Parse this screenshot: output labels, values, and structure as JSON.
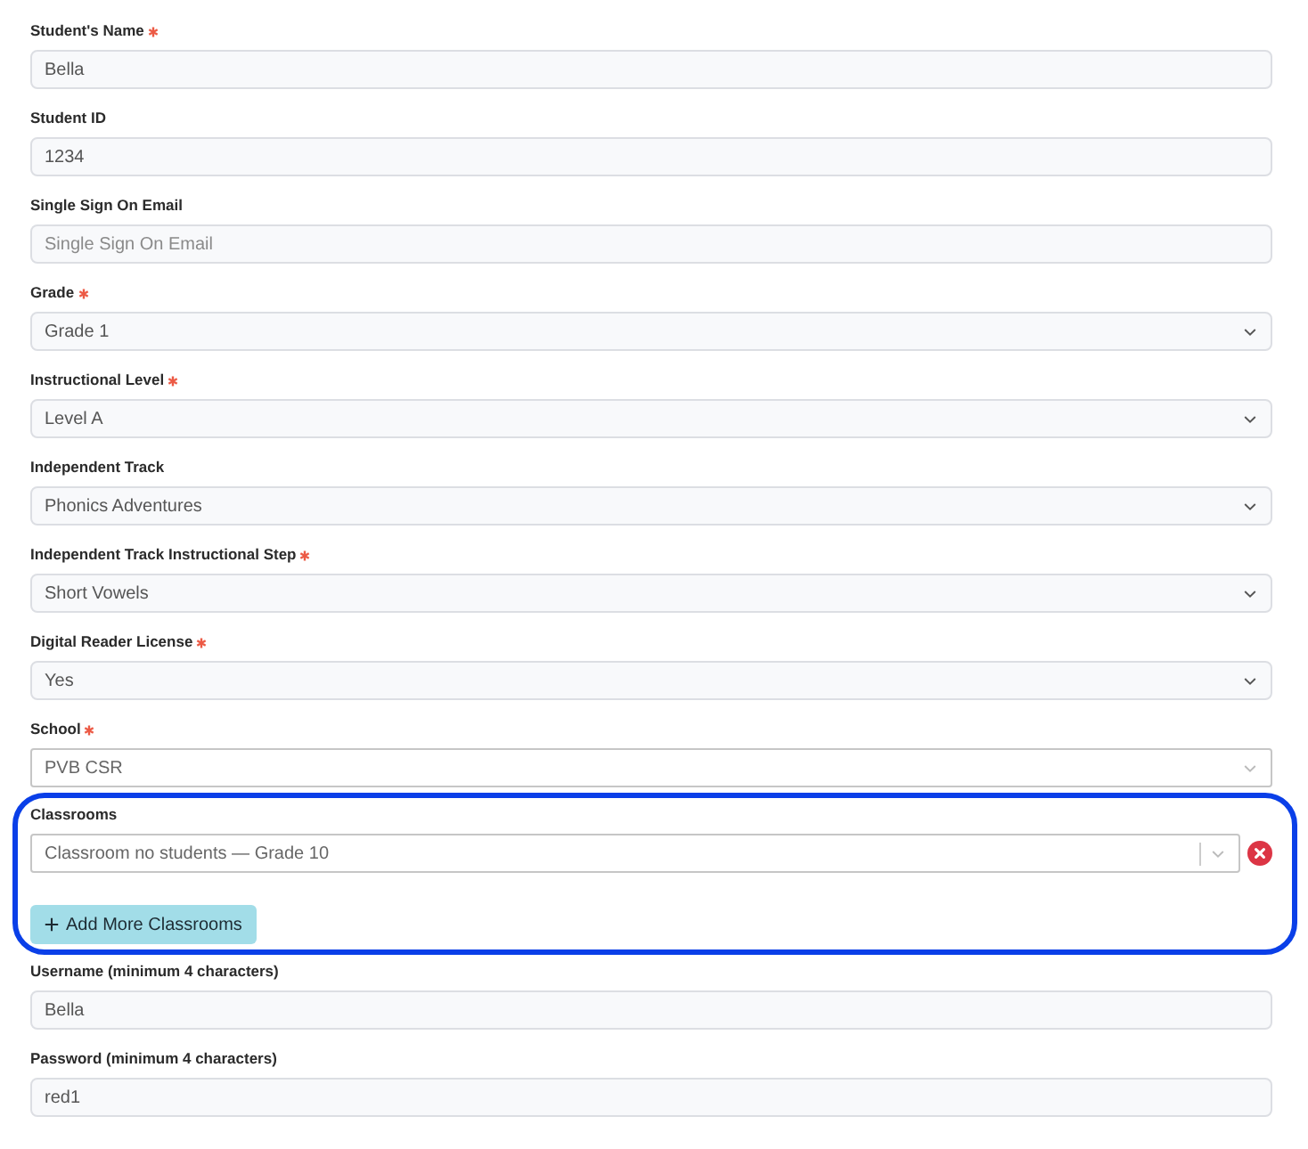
{
  "fields": [
    {
      "label": "Student's Name",
      "required": true,
      "kind": "input",
      "value": "Bella"
    },
    {
      "label": "Student ID",
      "required": false,
      "kind": "input",
      "value": "1234"
    },
    {
      "label": "Single Sign On Email",
      "required": false,
      "kind": "input",
      "placeholder": "Single Sign On Email"
    },
    {
      "label": "Grade",
      "required": true,
      "kind": "select",
      "value": "Grade 1"
    },
    {
      "label": "Instructional Level",
      "required": true,
      "kind": "select",
      "value": "Level A"
    },
    {
      "label": "Independent Track",
      "required": false,
      "kind": "select",
      "value": "Phonics Adventures"
    },
    {
      "label": "Independent Track Instructional Step",
      "required": true,
      "kind": "select",
      "value": "Short Vowels"
    },
    {
      "label": "Digital Reader License",
      "required": true,
      "kind": "select",
      "value": "Yes"
    },
    {
      "label": "School",
      "required": true,
      "kind": "combo",
      "value": "PVB CSR"
    }
  ],
  "classrooms": {
    "label": "Classrooms",
    "highlighted": true,
    "items": [
      {
        "value": "Classroom no students — Grade 10"
      }
    ],
    "add_button": "Add More Classrooms"
  },
  "account_fields": [
    {
      "label": "Username (minimum 4 characters)",
      "required": false,
      "kind": "input",
      "value": "Bella"
    },
    {
      "label": "Password (minimum 4 characters)",
      "required": false,
      "kind": "input",
      "value": "red1"
    }
  ]
}
